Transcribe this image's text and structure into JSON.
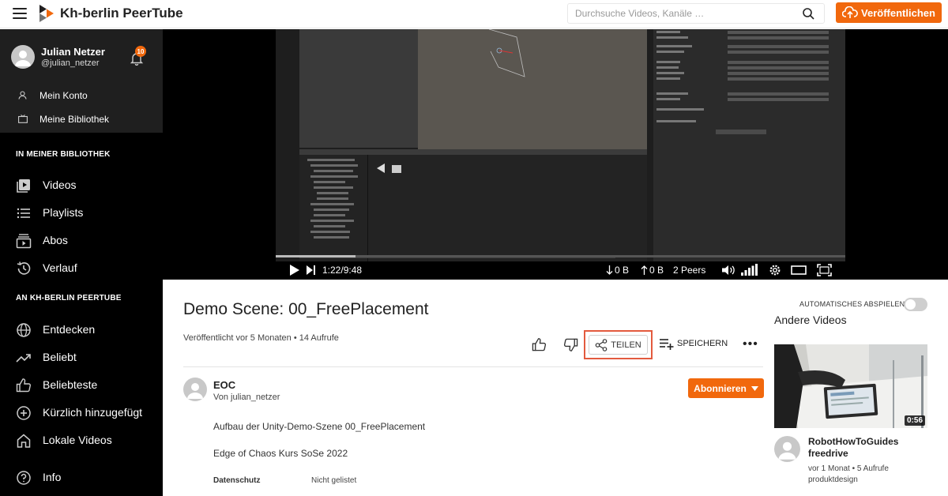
{
  "header": {
    "site_title": "Kh-berlin PeerTube",
    "search_placeholder": "Durchsuche Videos, Kanäle …",
    "publish_label": "Veröffentlichen"
  },
  "user": {
    "name": "Julian Netzer",
    "handle": "@julian_netzer",
    "notification_count": "10"
  },
  "account_menu": [
    {
      "label": "Mein Konto",
      "icon": "person-icon"
    },
    {
      "label": "Meine Bibliothek",
      "icon": "tv-icon"
    }
  ],
  "library": {
    "title": "IN MEINER BIBLIOTHEK",
    "items": [
      {
        "label": "Videos",
        "icon": "video-icon"
      },
      {
        "label": "Playlists",
        "icon": "list-icon"
      },
      {
        "label": "Abos",
        "icon": "subscriptions-icon"
      },
      {
        "label": "Verlauf",
        "icon": "history-icon"
      }
    ]
  },
  "instance": {
    "title": "AN KH-BERLIN PEERTUBE",
    "items": [
      {
        "label": "Entdecken",
        "icon": "globe-icon"
      },
      {
        "label": "Beliebt",
        "icon": "trending-icon"
      },
      {
        "label": "Beliebteste",
        "icon": "thumbs-up-icon"
      },
      {
        "label": "Kürzlich hinzugefügt",
        "icon": "plus-circle-icon"
      },
      {
        "label": "Lokale Videos",
        "icon": "home-icon"
      }
    ]
  },
  "info_label": "Info",
  "player": {
    "time": "1:22/9:48",
    "download": "0 B",
    "upload": "0 B",
    "peers": "2 Peers",
    "progress": 0.14
  },
  "video": {
    "title": "Demo Scene: 00_FreePlacement",
    "meta": "Veröffentlicht vor 5 Monaten • 14 Aufrufe",
    "share_label": "TEILEN",
    "save_label": "SPEICHERN",
    "more_label": "•••"
  },
  "channel": {
    "name": "EOC",
    "by": "Von julian_netzer",
    "subscribe_label": "Abonnieren"
  },
  "description": {
    "line1": "Aufbau der Unity-Demo-Szene 00_FreePlacement",
    "line2": "Edge of Chaos Kurs SoSe 2022"
  },
  "attributes": [
    {
      "key": "Datenschutz",
      "value": "Nicht gelistet"
    }
  ],
  "sidebar_right": {
    "autoplay_label": "AUTOMATISCHES ABSPIELEN",
    "other_videos": "Andere Videos",
    "recommendation": {
      "duration": "0:56",
      "title": "RobotHowToGuides freedrive",
      "meta": "vor 1 Monat • 5 Aufrufe",
      "channel": "produktdesign"
    }
  },
  "colors": {
    "accent": "#f1680d",
    "share_highlight": "#e35a3e"
  }
}
